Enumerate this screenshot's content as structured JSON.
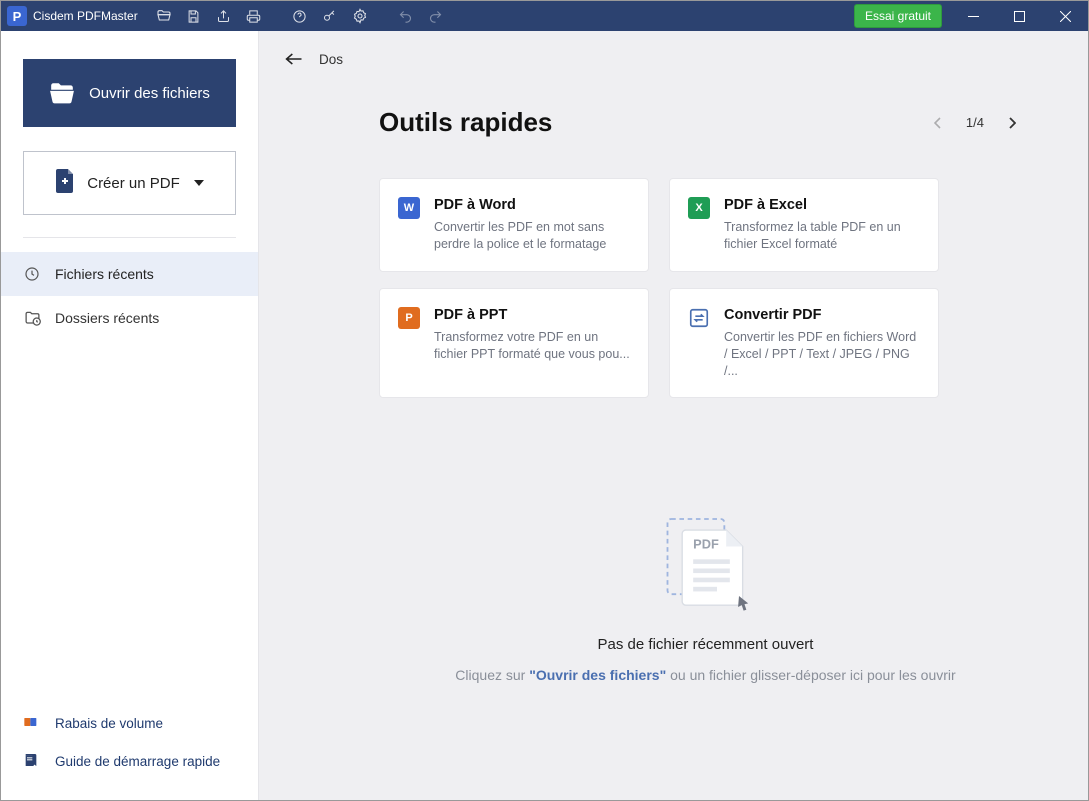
{
  "app": {
    "title": "Cisdem PDFMaster"
  },
  "titlebar": {
    "trial_label": "Essai gratuit"
  },
  "sidebar": {
    "open_label": "Ouvrir des fichiers",
    "create_label": "Créer un PDF",
    "nav": {
      "recent_files": "Fichiers récents",
      "recent_folders": "Dossiers récents"
    },
    "links": {
      "volume_discount": "Rabais de volume",
      "quick_start": "Guide de démarrage rapide"
    }
  },
  "main": {
    "back_label": "Dos",
    "section_title": "Outils rapides",
    "pager": {
      "label": "1/4"
    },
    "cards": [
      {
        "title": "PDF à Word",
        "desc": "Convertir les PDF en mot sans perdre la police et le formatage",
        "icon_bg": "#3a66d1",
        "icon_letter": "W"
      },
      {
        "title": "PDF à Excel",
        "desc": "Transformez la table PDF en un fichier Excel formaté",
        "icon_bg": "#1f9d55",
        "icon_letter": "X"
      },
      {
        "title": "PDF à PPT",
        "desc": "Transformez votre PDF en un fichier PPT formaté que vous pou...",
        "icon_bg": "#e06c1f",
        "icon_letter": "P"
      },
      {
        "title": "Convertir PDF",
        "desc": "Convertir les PDF en fichiers Word / Excel / PPT / Text / JPEG / PNG /...",
        "icon_bg": "#4a6fb0",
        "icon_letter": "⇄"
      }
    ],
    "empty": {
      "title": "Pas de fichier récemment ouvert",
      "pre": "Cliquez sur ",
      "link": "\"Ouvrir des fichiers\"",
      "post": " ou un fichier glisser-déposer ici pour les ouvrir"
    }
  }
}
